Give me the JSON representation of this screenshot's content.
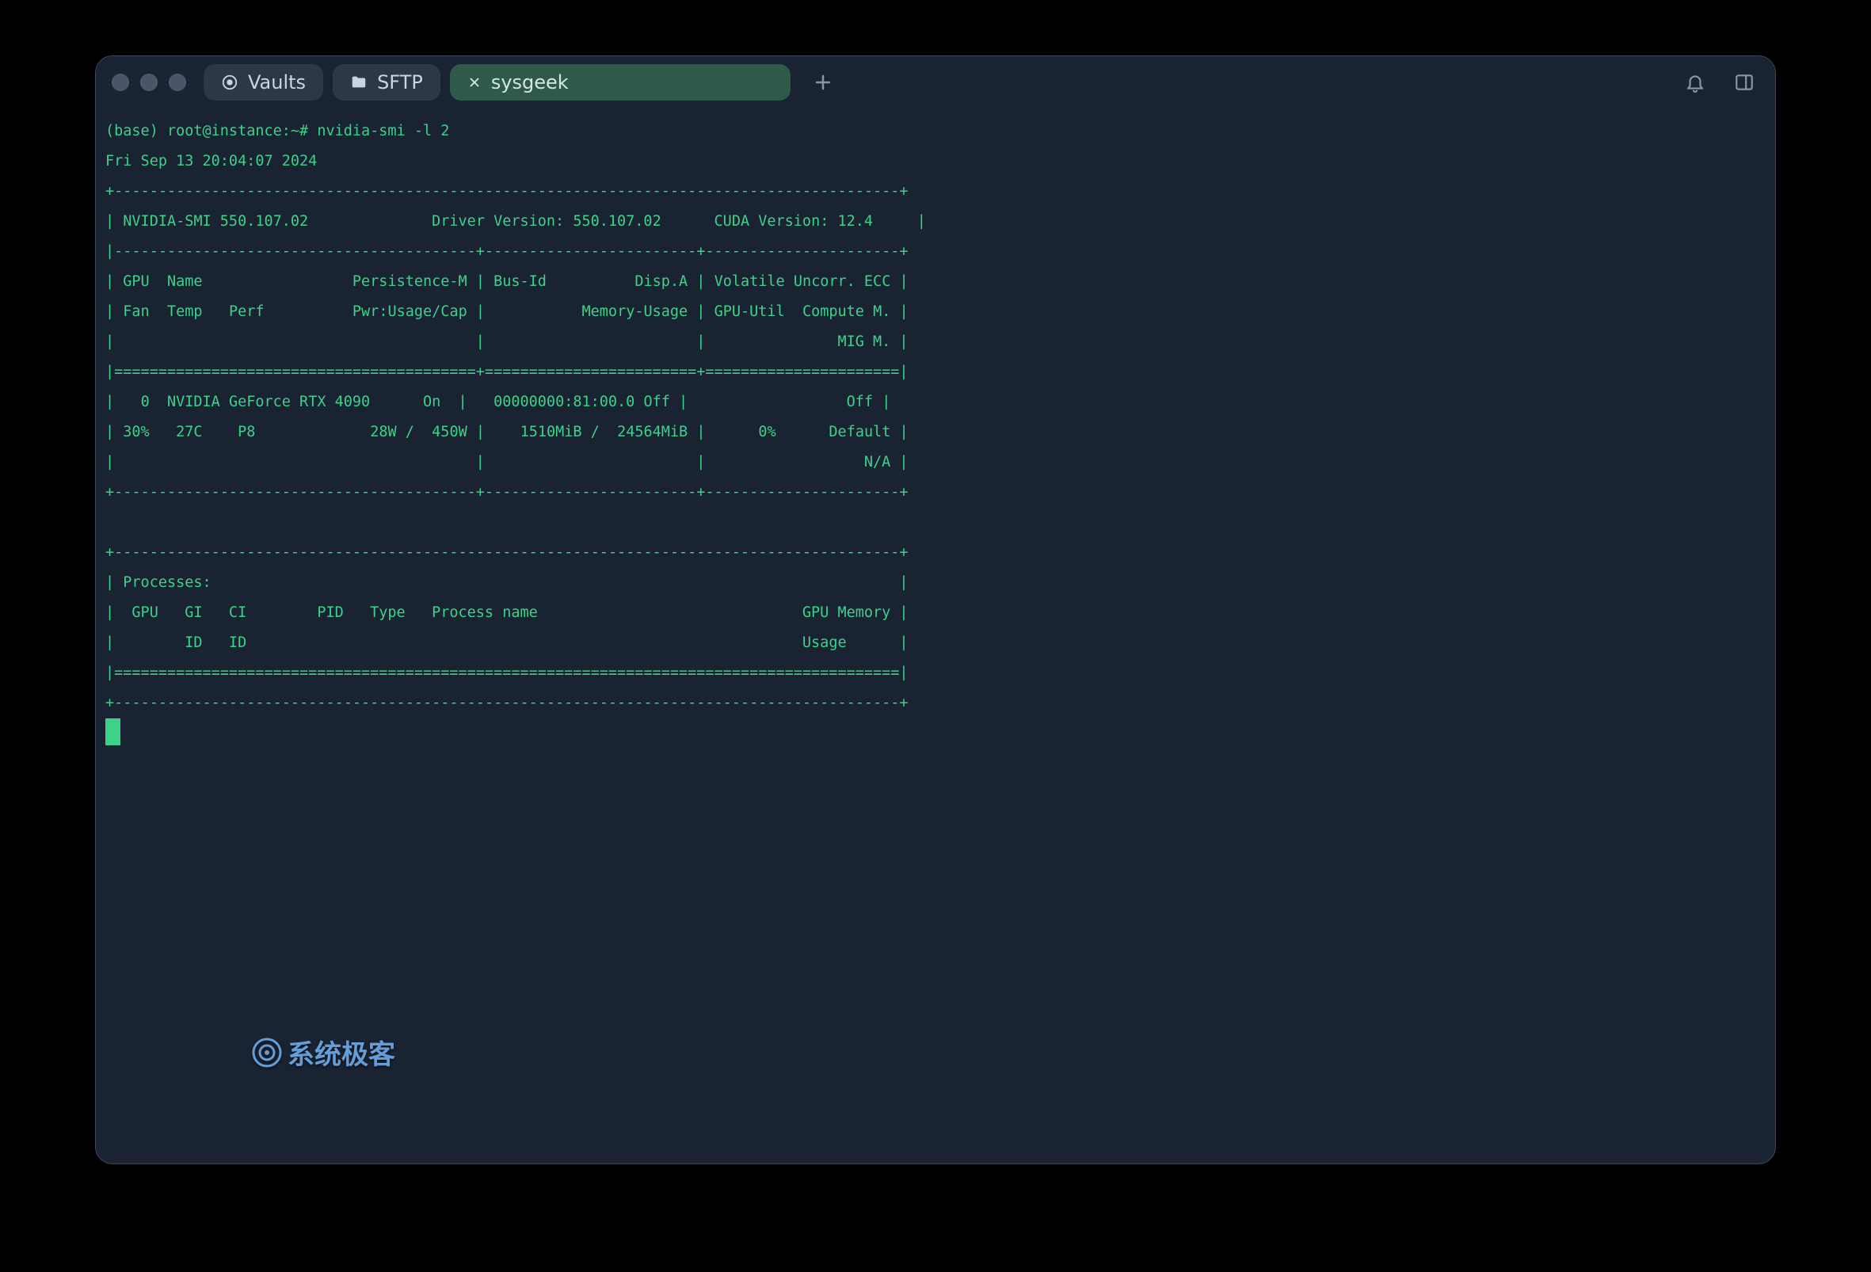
{
  "tabs": {
    "vaults": "Vaults",
    "sftp": "SFTP",
    "active": "sysgeek"
  },
  "prompt": "(base) root@instance:~# ",
  "command": "nvidia-smi -l 2",
  "timestamp": "Fri Sep 13 20:04:07 2024",
  "smi": {
    "version": "NVIDIA-SMI 550.107.02",
    "driver_label": "Driver Version: 550.107.02",
    "cuda_label": "CUDA Version: 12.4",
    "hdr_gpu_name": "GPU  Name",
    "hdr_persist": "Persistence-M",
    "hdr_bus": "Bus-Id",
    "hdr_disp": "Disp.A",
    "hdr_volatile": "Volatile Uncorr. ECC",
    "hdr_fan": "Fan",
    "hdr_temp": "Temp",
    "hdr_perf": "Perf",
    "hdr_pwr": "Pwr:Usage/Cap",
    "hdr_mem": "Memory-Usage",
    "hdr_gpuutil": "GPU-Util",
    "hdr_compute": "Compute M.",
    "hdr_mig": "MIG M.",
    "row": {
      "idx": "0",
      "name": "NVIDIA GeForce RTX 4090",
      "persist": "On",
      "bus": "00000000:81:00.0",
      "disp": "Off",
      "ecc": "Off",
      "fan": "30%",
      "temp": "27C",
      "perf": "P8",
      "pwr_usage": "28W",
      "pwr_cap": "450W",
      "mem_used": "1510MiB",
      "mem_total": "24564MiB",
      "gpuutil": "0%",
      "compute": "Default",
      "mig": "N/A"
    },
    "proc_hdr": "Processes:",
    "proc_cols1": "  GPU   GI   CI        PID   Type   Process name                              GPU Memory ",
    "proc_cols2": "        ID   ID                                                               Usage      "
  },
  "watermark": "系统极客"
}
